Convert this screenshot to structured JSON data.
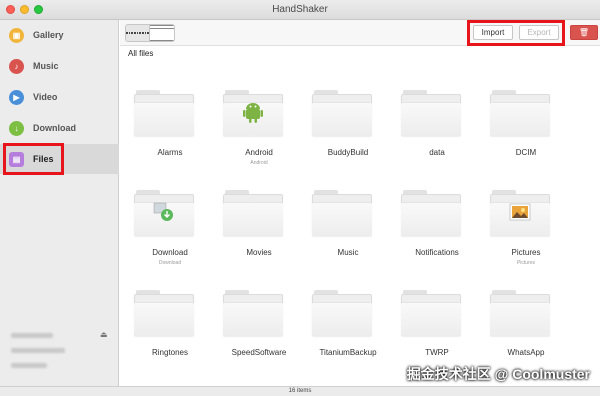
{
  "window": {
    "title": "HandShaker"
  },
  "sidebar": {
    "items": [
      {
        "label": "Gallery",
        "icon": "gallery-icon",
        "color": "#f2b53c"
      },
      {
        "label": "Music",
        "icon": "music-icon",
        "color": "#d9534f"
      },
      {
        "label": "Video",
        "icon": "video-icon",
        "color": "#4a90d9"
      },
      {
        "label": "Download",
        "icon": "download-icon",
        "color": "#7cbf43"
      },
      {
        "label": "Files",
        "icon": "files-icon",
        "color": "#b57edc"
      }
    ]
  },
  "toolbar": {
    "import_label": "Import",
    "export_label": "Export"
  },
  "breadcrumb": {
    "label": "All files"
  },
  "files": [
    {
      "name": "Alarms",
      "sub": ""
    },
    {
      "name": "Android",
      "sub": "Android"
    },
    {
      "name": "BuddyBuild",
      "sub": ""
    },
    {
      "name": "data",
      "sub": ""
    },
    {
      "name": "DCIM",
      "sub": ""
    },
    {
      "name": "Download",
      "sub": "Download"
    },
    {
      "name": "Movies",
      "sub": ""
    },
    {
      "name": "Music",
      "sub": ""
    },
    {
      "name": "Notifications",
      "sub": ""
    },
    {
      "name": "Pictures",
      "sub": "Pictures"
    },
    {
      "name": "Ringtones",
      "sub": ""
    },
    {
      "name": "SpeedSoftware",
      "sub": ""
    },
    {
      "name": "TitaniumBackup",
      "sub": ""
    },
    {
      "name": "TWRP",
      "sub": ""
    },
    {
      "name": "WhatsApp",
      "sub": ""
    }
  ],
  "status": {
    "count": "16 items"
  },
  "watermark": {
    "text": "掘金技术社区 @ Coolmuster"
  }
}
